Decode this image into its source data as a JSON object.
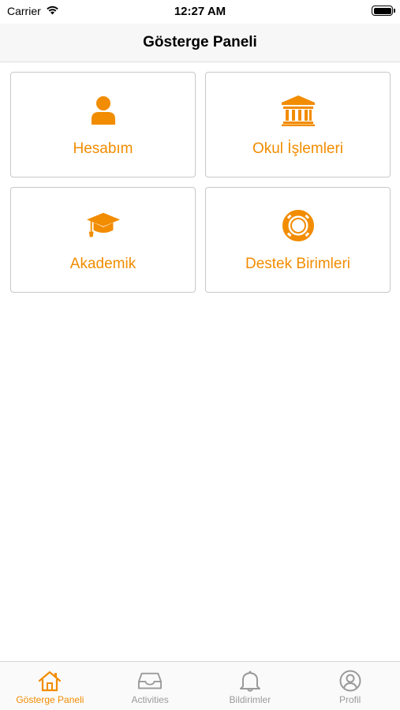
{
  "status_bar": {
    "carrier": "Carrier",
    "time": "12:27 AM"
  },
  "nav": {
    "title": "Gösterge Paneli"
  },
  "tiles": [
    {
      "label": "Hesabım",
      "icon": "user-icon"
    },
    {
      "label": "Okul İşlemleri",
      "icon": "institution-icon"
    },
    {
      "label": "Akademik",
      "icon": "graduation-cap-icon"
    },
    {
      "label": "Destek Birimleri",
      "icon": "life-ring-icon"
    }
  ],
  "tab_bar": {
    "items": [
      {
        "label": "Gösterge Paneli",
        "icon": "home-icon",
        "active": true
      },
      {
        "label": "Activities",
        "icon": "inbox-icon",
        "active": false
      },
      {
        "label": "Bildirimler",
        "icon": "bell-icon",
        "active": false
      },
      {
        "label": "Profil",
        "icon": "profile-icon",
        "active": false
      }
    ]
  },
  "colors": {
    "accent": "#f28c00",
    "inactive": "#9a9a9a",
    "border": "#c8c8c8"
  }
}
